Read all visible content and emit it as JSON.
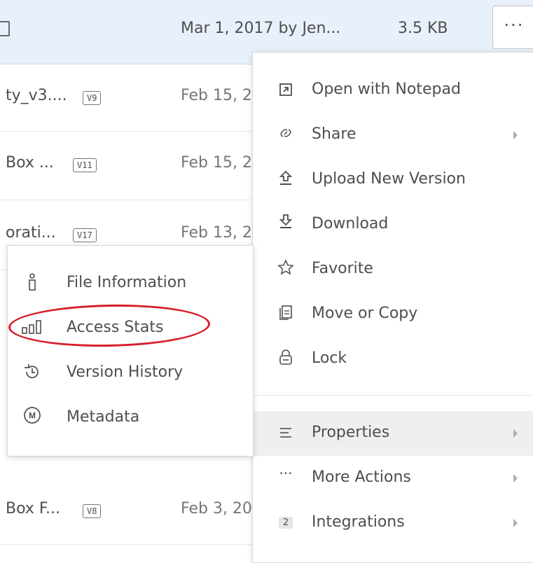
{
  "rows": [
    {
      "name": "",
      "version": "",
      "date": "Mar 1, 2017 by Jen...",
      "size": "3.5 KB",
      "selected": true
    },
    {
      "name": "ty_v3....",
      "version": "V9",
      "date": "Feb 15, 2"
    },
    {
      "name": "Box ...",
      "version": "V11",
      "date": "Feb 15, 2"
    },
    {
      "name": "orati...",
      "version": "V17",
      "date": "Feb 13, 2"
    },
    {
      "name": "Box F...",
      "version": "V8",
      "date": "Feb 3, 20"
    }
  ],
  "more_button": {
    "label": "···"
  },
  "menu": {
    "items": [
      {
        "label": "Open with Notepad",
        "icon": "open-external-icon"
      },
      {
        "label": "Share",
        "icon": "link-icon",
        "submenu": true
      },
      {
        "label": "Upload New Version",
        "icon": "upload-icon"
      },
      {
        "label": "Download",
        "icon": "download-icon"
      },
      {
        "label": "Favorite",
        "icon": "star-icon"
      },
      {
        "label": "Move or Copy",
        "icon": "copy-icon"
      },
      {
        "label": "Lock",
        "icon": "lock-icon"
      },
      {
        "label": "Properties",
        "icon": "properties-icon",
        "submenu": true,
        "active": true
      },
      {
        "label": "More Actions",
        "icon": "ellipsis-icon",
        "submenu": true
      },
      {
        "label": "Integrations",
        "icon": "integrations-badge",
        "badge": "2",
        "submenu": true
      }
    ]
  },
  "submenu": {
    "items": [
      {
        "label": "File Information",
        "icon": "info-icon"
      },
      {
        "label": "Access Stats",
        "icon": "bar-chart-icon",
        "highlighted": true
      },
      {
        "label": "Version History",
        "icon": "history-icon"
      },
      {
        "label": "Metadata",
        "icon": "metadata-icon",
        "glyph": "M"
      }
    ]
  },
  "colors": {
    "selected_row": "#e8f1fb",
    "highlight_ring": "#d61e2a",
    "text": "#4e4e4e"
  }
}
